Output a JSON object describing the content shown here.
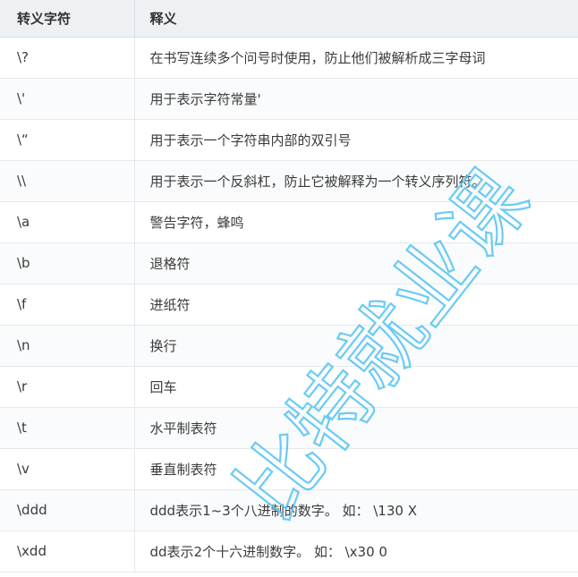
{
  "table": {
    "headers": {
      "seq": "转义字符",
      "desc": "释义"
    },
    "rows": [
      {
        "seq": "\\?",
        "desc": "在书写连续多个问号时使用，防止他们被解析成三字母词"
      },
      {
        "seq": "\\'",
        "desc": "用于表示字符常量'"
      },
      {
        "seq": "\\“",
        "desc": "用于表示一个字符串内部的双引号"
      },
      {
        "seq": "\\\\",
        "desc": "用于表示一个反斜杠，防止它被解释为一个转义序列符。"
      },
      {
        "seq": "\\a",
        "desc": "警告字符，蜂鸣"
      },
      {
        "seq": "\\b",
        "desc": "退格符"
      },
      {
        "seq": "\\f",
        "desc": "进纸符"
      },
      {
        "seq": "\\n",
        "desc": "换行"
      },
      {
        "seq": "\\r",
        "desc": "回车"
      },
      {
        "seq": "\\t",
        "desc": "水平制表符"
      },
      {
        "seq": "\\v",
        "desc": "垂直制表符"
      },
      {
        "seq": "\\ddd",
        "desc": "ddd表示1~3个八进制的数字。 如： \\130 X"
      },
      {
        "seq": "\\xdd",
        "desc": "dd表示2个十六进制数字。 如： \\x30 0"
      }
    ]
  },
  "watermark": {
    "text": "比特就业课",
    "color": "#5bc6f2"
  }
}
